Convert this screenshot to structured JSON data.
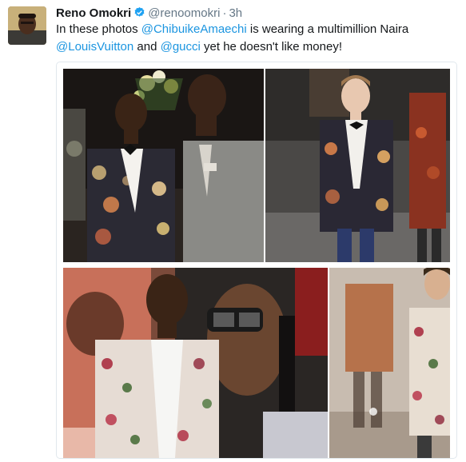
{
  "tweet": {
    "author_name": "Reno Omokri",
    "handle": "@renoomokri",
    "separator": "·",
    "time": "3h",
    "text_parts": {
      "t1": "In these photos ",
      "m1": "@ChibuikeAmaechi",
      "t2": " is wearing a multimillion Naira ",
      "m2": "@LouisVuitton",
      "t3": " and ",
      "m3": "@gucci",
      "t4": " yet he doesn't like money!"
    }
  },
  "icons": {
    "verified": "verified-badge-icon"
  },
  "colors": {
    "link": "#1b95e0",
    "verified": "#1da1f2",
    "text": "#14171a",
    "muted": "#657786"
  }
}
